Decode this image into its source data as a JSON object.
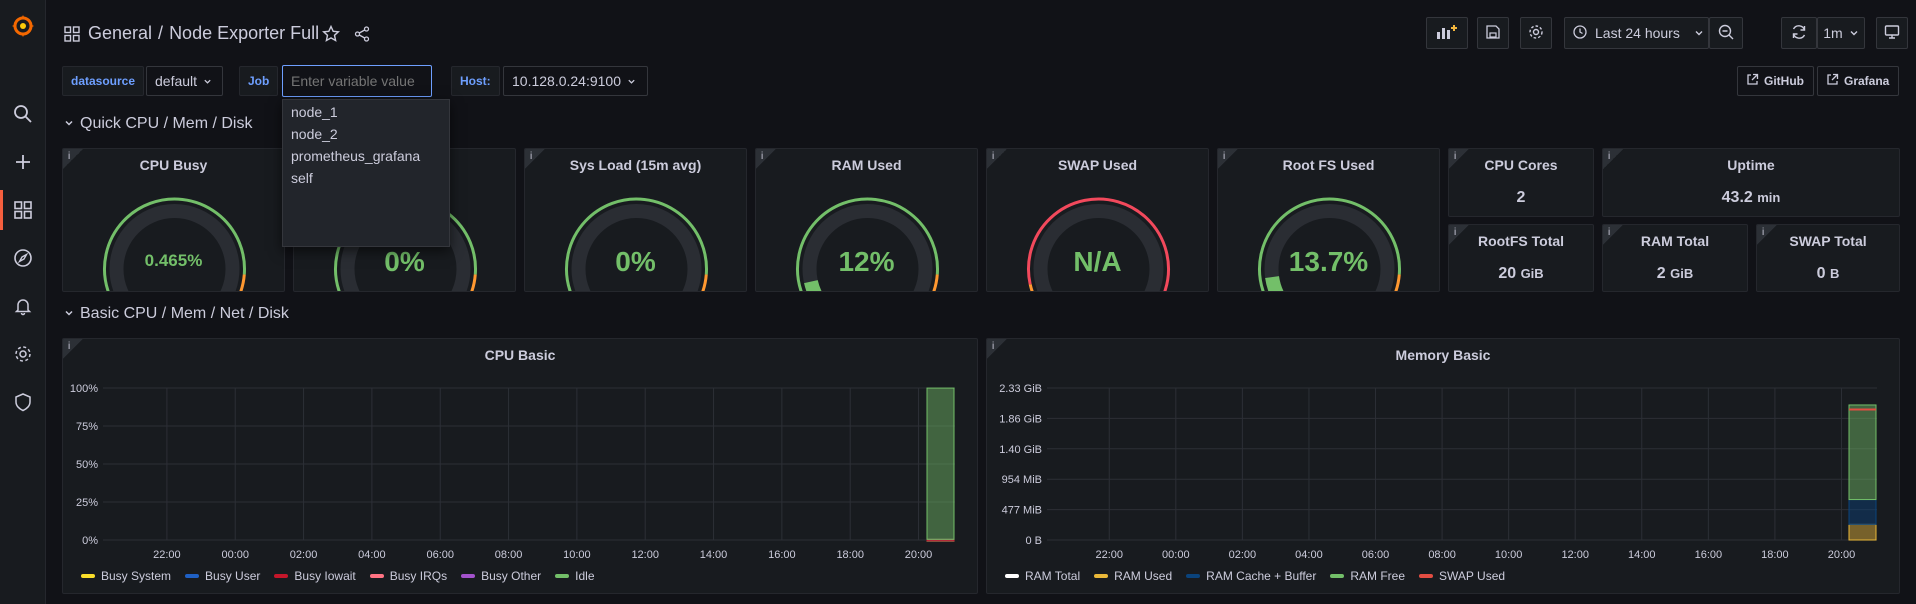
{
  "breadcrumb": {
    "folder": "General",
    "separator": "/",
    "dashboard": "Node Exporter Full"
  },
  "toolbar": {
    "time_range": "Last 24 hours",
    "refresh_interval": "1m"
  },
  "variables": [
    {
      "label": "datasource",
      "value": "default"
    },
    {
      "label": "Job",
      "value": "",
      "placeholder": "Enter variable value"
    },
    {
      "label": "Host:",
      "value": "10.128.0.24:9100"
    }
  ],
  "links": [
    {
      "label": "GitHub"
    },
    {
      "label": "Grafana"
    }
  ],
  "job_dropdown": {
    "options": [
      "node_1",
      "node_2",
      "prometheus_grafana",
      "self"
    ]
  },
  "rows": [
    {
      "title": "Quick CPU / Mem / Disk"
    },
    {
      "title": "Basic CPU / Mem / Net / Disk"
    }
  ],
  "gauges": [
    {
      "title": "CPU Busy",
      "value": "0.465%",
      "level": 0.00465,
      "thresholds": "green-orange-red"
    },
    {
      "title": "Sys Load (5m avg)",
      "visible_title": "g)",
      "value": "0%",
      "level": 0,
      "thresholds": "green-orange-red"
    },
    {
      "title": "Sys Load (15m avg)",
      "value": "0%",
      "level": 0,
      "thresholds": "green-orange-red"
    },
    {
      "title": "RAM Used",
      "value": "12%",
      "level": 0.12,
      "thresholds": "green-orange-red"
    },
    {
      "title": "SWAP Used",
      "value": "N/A",
      "level": 0,
      "thresholds": "red-green"
    },
    {
      "title": "Root FS Used",
      "value": "13.7%",
      "level": 0.137,
      "thresholds": "green-orange-red"
    }
  ],
  "stats": [
    {
      "title": "CPU Cores",
      "value": "2",
      "unit": ""
    },
    {
      "title": "Uptime",
      "value": "43.2",
      "unit": "min"
    },
    {
      "title": "RootFS Total",
      "value": "20",
      "unit": "GiB"
    },
    {
      "title": "RAM Total",
      "value": "2",
      "unit": "GiB"
    },
    {
      "title": "SWAP Total",
      "value": "0",
      "unit": "B"
    }
  ],
  "colors": {
    "green": "#73bf69",
    "dark_green": "#37872d",
    "orange": "#ff9830",
    "red": "#f2495c",
    "accent": "#f55f3e",
    "link": "#6e9fff",
    "background": "#111217",
    "panel": "#181b1f"
  },
  "chart_data": [
    {
      "type": "area",
      "title": "CPU Basic",
      "y_ticks": [
        "100%",
        "75%",
        "50%",
        "25%",
        "0%"
      ],
      "ylim": [
        0,
        100
      ],
      "x_ticks": [
        "22:00",
        "00:00",
        "02:00",
        "04:00",
        "06:00",
        "08:00",
        "10:00",
        "12:00",
        "14:00",
        "16:00",
        "18:00",
        "20:00"
      ],
      "series": [
        {
          "name": "Busy System",
          "color": "#fade2a",
          "values": [
            0.2
          ]
        },
        {
          "name": "Busy User",
          "color": "#1f60c4",
          "values": [
            0.2
          ]
        },
        {
          "name": "Busy Iowait",
          "color": "#c4162a",
          "values": [
            0.05
          ]
        },
        {
          "name": "Busy IRQs",
          "color": "#ff7383",
          "values": [
            0
          ]
        },
        {
          "name": "Busy Other",
          "color": "#a352cc",
          "values": [
            0
          ]
        },
        {
          "name": "Idle",
          "color": "#73bf69",
          "values": [
            99.5
          ]
        }
      ],
      "legend_placement": "bottom-left"
    },
    {
      "type": "area",
      "title": "Memory Basic",
      "y_ticks": [
        "2.33 GiB",
        "1.86 GiB",
        "1.40 GiB",
        "954 MiB",
        "477 MiB",
        "0 B"
      ],
      "x_ticks": [
        "22:00",
        "00:00",
        "02:00",
        "04:00",
        "06:00",
        "08:00",
        "10:00",
        "12:00",
        "14:00",
        "16:00",
        "18:00",
        "20:00"
      ],
      "series": [
        {
          "name": "RAM Total",
          "color": "#ffffff",
          "values": [
            2.0
          ]
        },
        {
          "name": "RAM Used",
          "color": "#eab839",
          "values": [
            0.24
          ]
        },
        {
          "name": "RAM Cache + Buffer",
          "color": "#0a437c",
          "values": [
            0.38
          ]
        },
        {
          "name": "RAM Free",
          "color": "#73bf69",
          "values": [
            1.45
          ]
        },
        {
          "name": "SWAP Used",
          "color": "#e24d42",
          "values": [
            0
          ]
        }
      ],
      "legend_placement": "bottom-left"
    }
  ]
}
